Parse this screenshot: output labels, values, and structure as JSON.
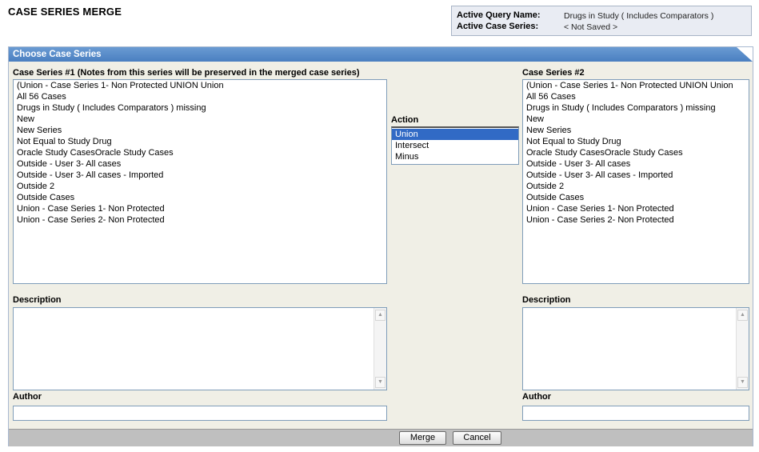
{
  "page": {
    "title": "CASE SERIES MERGE"
  },
  "query_info": {
    "query_name_label": "Active Query Name:",
    "query_name_value": "Drugs in Study ( Includes Comparators )",
    "case_series_label": "Active Case Series:",
    "case_series_value": "< Not Saved >"
  },
  "panel": {
    "title": "Choose Case Series"
  },
  "series1": {
    "label": "Case Series #1 (Notes from this series will be preserved in the merged case series)",
    "items": [
      "(Union - Case Series 1- Non Protected UNION Union",
      "All 56 Cases",
      "Drugs in Study ( Includes Comparators ) missing",
      "New",
      "New Series",
      "Not Equal to Study Drug",
      "Oracle Study CasesOracle Study Cases",
      "Outside - User 3- All cases",
      "Outside - User 3- All cases - Imported",
      "Outside 2",
      "Outside Cases",
      "Union - Case Series 1- Non Protected",
      "Union - Case Series 2- Non Protected"
    ],
    "description_label": "Description",
    "description_value": "",
    "author_label": "Author",
    "author_value": ""
  },
  "action": {
    "label": "Action",
    "options": [
      "Union",
      "Intersect",
      "Minus"
    ],
    "selected": "Union"
  },
  "series2": {
    "label": "Case Series #2",
    "items": [
      "(Union - Case Series 1- Non Protected UNION Union",
      "All 56 Cases",
      "Drugs in Study ( Includes Comparators ) missing",
      "New",
      "New Series",
      "Not Equal to Study Drug",
      "Oracle Study CasesOracle Study Cases",
      "Outside - User 3- All cases",
      "Outside - User 3- All cases - Imported",
      "Outside 2",
      "Outside Cases",
      "Union - Case Series 1- Non Protected",
      "Union - Case Series 2- Non Protected"
    ],
    "description_label": "Description",
    "description_value": "",
    "author_label": "Author",
    "author_value": ""
  },
  "buttons": {
    "merge": "Merge",
    "cancel": "Cancel"
  },
  "icons": {
    "scroll_up": "scroll-up-arrow-icon",
    "scroll_down": "scroll-down-arrow-icon"
  },
  "colors": {
    "header_blue": "#4a7fc1",
    "selection": "#316ac5",
    "panel_bg": "#f0efe6"
  }
}
